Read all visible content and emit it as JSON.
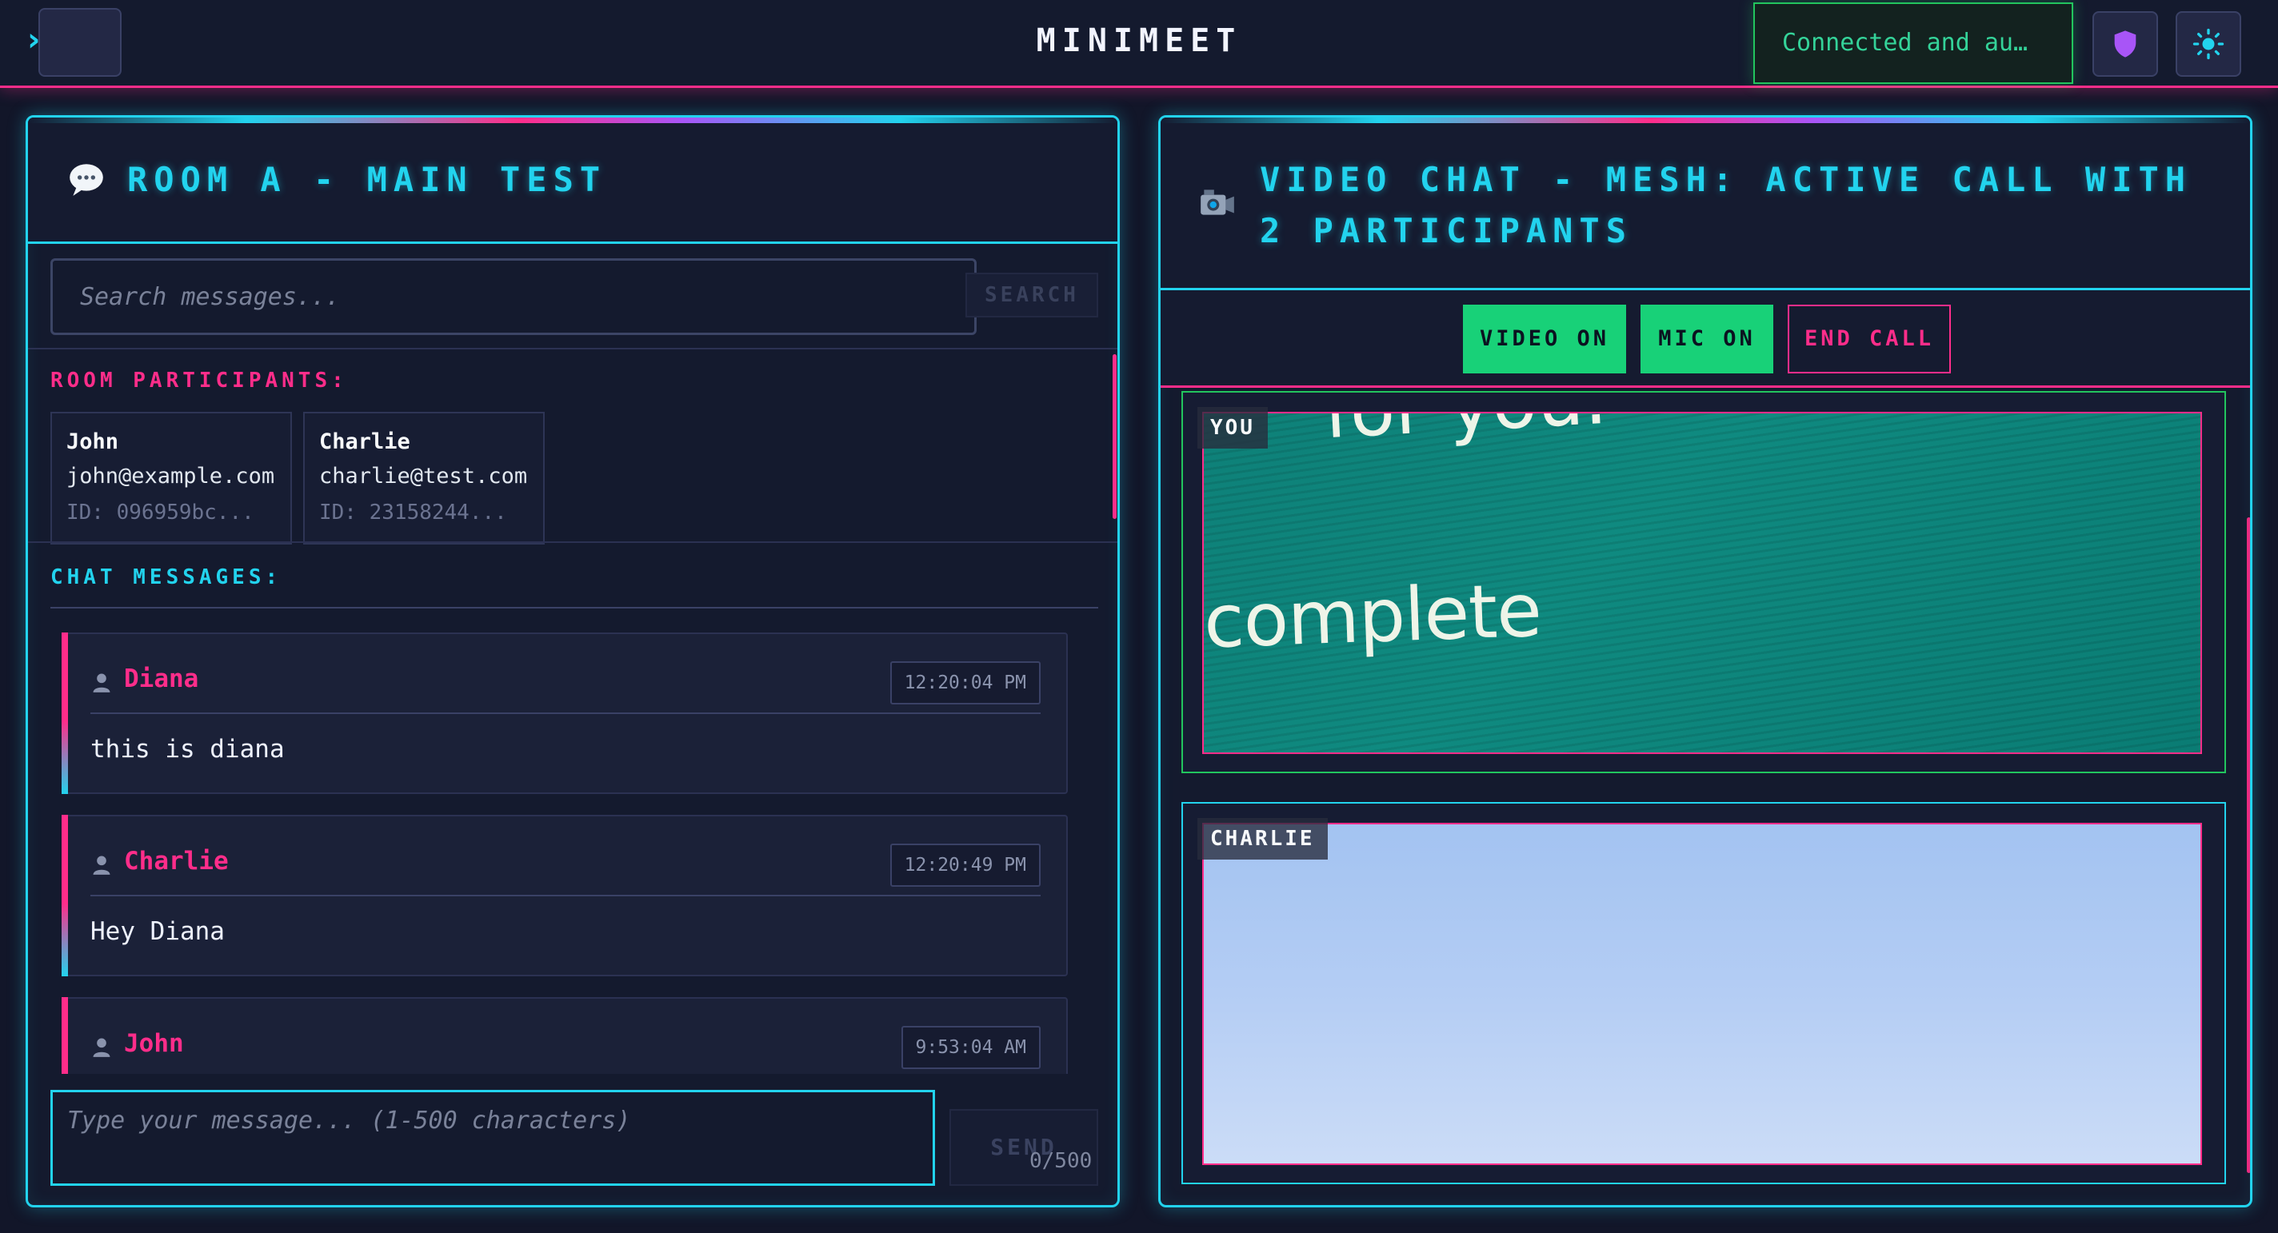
{
  "app": {
    "title": "MINIMEET",
    "connection_status": "Connected and au…"
  },
  "colors": {
    "cyan": "#22d3ee",
    "pink": "#ff2d8a",
    "green": "#18d178",
    "background": "#121629"
  },
  "icons": {
    "menu": "chevron-right-icon",
    "shield": "shield-icon",
    "theme": "sun-icon",
    "chat": "speech-bubble-icon",
    "video": "camera-icon",
    "user": "user-icon"
  },
  "chat_panel": {
    "title": "ROOM A - MAIN TEST",
    "search": {
      "placeholder": "Search messages...",
      "button_label": "SEARCH"
    },
    "participants_label": "ROOM PARTICIPANTS:",
    "participants": [
      {
        "name": "John",
        "email": "john@example.com",
        "id": "ID: 096959bc..."
      },
      {
        "name": "Charlie",
        "email": "charlie@test.com",
        "id": "ID: 23158244..."
      }
    ],
    "messages_label": "CHAT MESSAGES:",
    "messages": [
      {
        "author": "Diana",
        "time": "12:20:04 PM",
        "text": "this is diana"
      },
      {
        "author": "Charlie",
        "time": "12:20:49 PM",
        "text": "Hey Diana"
      },
      {
        "author": "John",
        "time": "9:53:04 AM",
        "text": ""
      }
    ],
    "compose": {
      "placeholder": "Type your message... (1-500 characters)",
      "send_label": "SEND",
      "char_count": "0/500"
    }
  },
  "video_panel": {
    "title": "VIDEO CHAT - MESH: ACTIVE CALL WITH 2 PARTICIPANTS",
    "controls": {
      "video_label": "VIDEO ON",
      "mic_label": "MIC ON",
      "end_label": "END CALL"
    },
    "tiles": [
      {
        "label": "YOU",
        "feed_text_top": "for you.",
        "feed_text_main": "complete"
      },
      {
        "label": "CHARLIE"
      }
    ]
  }
}
